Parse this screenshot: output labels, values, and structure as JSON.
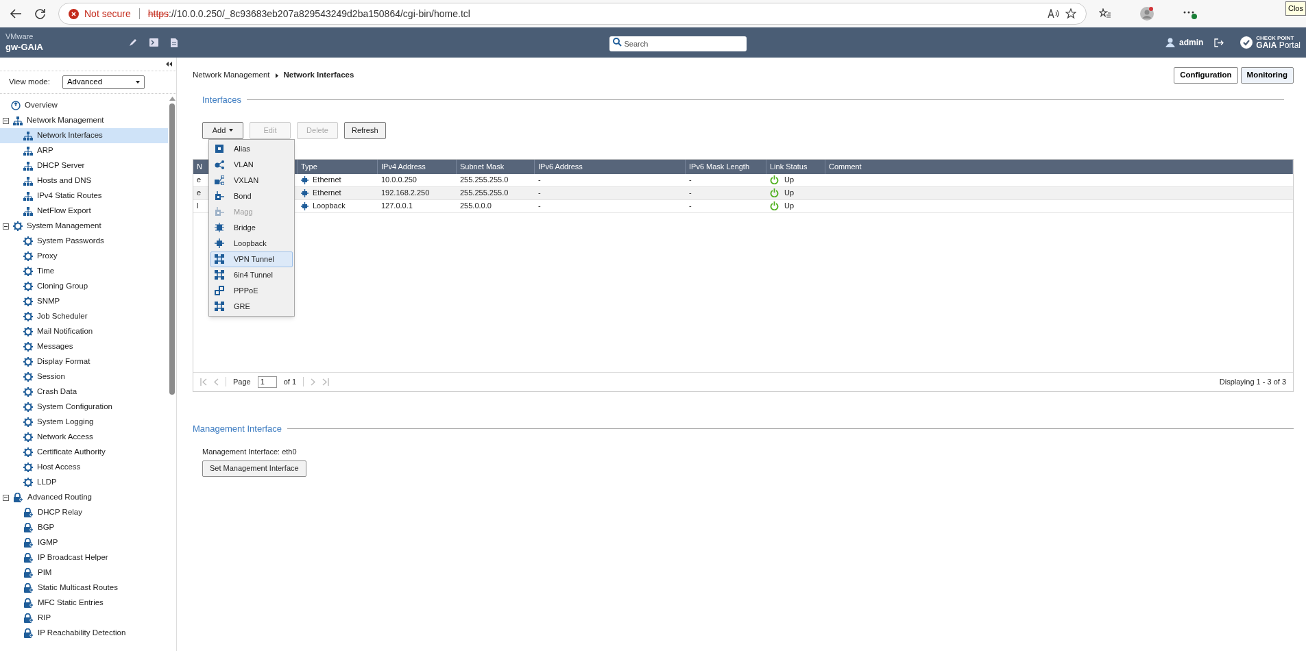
{
  "browser": {
    "security": "Not secure",
    "url_scheme": "https",
    "url_rest": "://10.0.0.250/_8c93683eb207a829543249d2ba150864/cgi-bin/home.tcl",
    "tooltip": "Clos"
  },
  "header": {
    "vendor": "VMware",
    "hostname": "gw-GAiA",
    "search": {
      "placeholder": "Search"
    },
    "user": "admin",
    "logo_top": "CHECK POINT",
    "logo_brand": "GAiA",
    "logo_word": "Portal"
  },
  "sidebar": {
    "view_mode_label": "View mode:",
    "view_mode": "Advanced",
    "tree": [
      {
        "label": "Overview",
        "kind": "overview",
        "selected": false
      },
      {
        "label": "Network Management",
        "kind": "network",
        "expanded": true,
        "selected": false,
        "children": [
          {
            "label": "Network Interfaces",
            "kind": "network",
            "selected": true
          },
          {
            "label": "ARP",
            "kind": "network",
            "selected": false
          },
          {
            "label": "DHCP Server",
            "kind": "network",
            "selected": false
          },
          {
            "label": "Hosts and DNS",
            "kind": "network",
            "selected": false
          },
          {
            "label": "IPv4 Static Routes",
            "kind": "network",
            "selected": false
          },
          {
            "label": "NetFlow Export",
            "kind": "network",
            "selected": false
          }
        ]
      },
      {
        "label": "System Management",
        "kind": "gear",
        "expanded": true,
        "selected": false,
        "children": [
          {
            "label": "System Passwords",
            "kind": "gear",
            "selected": false
          },
          {
            "label": "Proxy",
            "kind": "gear",
            "selected": false
          },
          {
            "label": "Time",
            "kind": "gear",
            "selected": false
          },
          {
            "label": "Cloning Group",
            "kind": "gear",
            "selected": false
          },
          {
            "label": "SNMP",
            "kind": "gear",
            "selected": false
          },
          {
            "label": "Job Scheduler",
            "kind": "gear",
            "selected": false
          },
          {
            "label": "Mail Notification",
            "kind": "gear",
            "selected": false
          },
          {
            "label": "Messages",
            "kind": "gear",
            "selected": false
          },
          {
            "label": "Display Format",
            "kind": "gear",
            "selected": false
          },
          {
            "label": "Session",
            "kind": "gear",
            "selected": false
          },
          {
            "label": "Crash Data",
            "kind": "gear",
            "selected": false
          },
          {
            "label": "System Configuration",
            "kind": "gear",
            "selected": false
          },
          {
            "label": "System Logging",
            "kind": "gear",
            "selected": false
          },
          {
            "label": "Network Access",
            "kind": "gear",
            "selected": false
          },
          {
            "label": "Certificate Authority",
            "kind": "gear",
            "selected": false
          },
          {
            "label": "Host Access",
            "kind": "gear",
            "selected": false
          },
          {
            "label": "LLDP",
            "kind": "gear",
            "selected": false
          }
        ]
      },
      {
        "label": "Advanced Routing",
        "kind": "lock",
        "expanded": true,
        "selected": false,
        "children": [
          {
            "label": "DHCP Relay",
            "kind": "lock",
            "selected": false
          },
          {
            "label": "BGP",
            "kind": "lock",
            "selected": false
          },
          {
            "label": "IGMP",
            "kind": "lock",
            "selected": false
          },
          {
            "label": "IP Broadcast Helper",
            "kind": "lock",
            "selected": false
          },
          {
            "label": "PIM",
            "kind": "lock",
            "selected": false
          },
          {
            "label": "Static Multicast Routes",
            "kind": "lock",
            "selected": false
          },
          {
            "label": "MFC Static Entries",
            "kind": "lock",
            "selected": false
          },
          {
            "label": "RIP",
            "kind": "lock",
            "selected": false
          },
          {
            "label": "IP Reachability Detection",
            "kind": "lock",
            "selected": false
          }
        ]
      }
    ]
  },
  "breadcrumb": [
    "Network Management",
    "Network Interfaces"
  ],
  "mode_buttons": [
    {
      "label": "Configuration",
      "selected": false
    },
    {
      "label": "Monitoring",
      "selected": true
    }
  ],
  "interfaces": {
    "title": "Interfaces",
    "toolbar": [
      {
        "label": "Add",
        "disabled": false,
        "dropdown": true
      },
      {
        "label": "Edit",
        "disabled": true,
        "dropdown": false
      },
      {
        "label": "Delete",
        "disabled": true,
        "dropdown": false
      },
      {
        "label": "Refresh",
        "disabled": false,
        "dropdown": false
      }
    ],
    "add_menu": [
      {
        "label": "Alias",
        "kind": "square",
        "disabled": false,
        "selected": false
      },
      {
        "label": "VLAN",
        "kind": "share",
        "disabled": false,
        "selected": false
      },
      {
        "label": "VXLAN",
        "kind": "branch",
        "disabled": false,
        "selected": false
      },
      {
        "label": "Bond",
        "kind": "bond",
        "disabled": false,
        "selected": false
      },
      {
        "label": "Magg",
        "kind": "bond",
        "disabled": true,
        "selected": false
      },
      {
        "label": "Bridge",
        "kind": "bridge",
        "disabled": false,
        "selected": false
      },
      {
        "label": "Loopback",
        "kind": "chip",
        "disabled": false,
        "selected": false
      },
      {
        "label": "VPN Tunnel",
        "kind": "tunnel",
        "disabled": false,
        "selected": true
      },
      {
        "label": "6in4 Tunnel",
        "kind": "tunnel",
        "disabled": false,
        "selected": false
      },
      {
        "label": "PPPoE",
        "kind": "link",
        "disabled": false,
        "selected": false
      },
      {
        "label": "GRE",
        "kind": "tunnel",
        "disabled": false,
        "selected": false
      }
    ],
    "columns": [
      "N",
      "Type",
      "IPv4 Address",
      "Subnet Mask",
      "IPv6 Address",
      "IPv6 Mask Length",
      "Link Status",
      "Comment"
    ],
    "rows": [
      {
        "column_1": "e",
        "type": "Ethernet",
        "ipv4": "10.0.0.250",
        "mask": "255.255.255.0",
        "ipv6": "-",
        "ipv6_mask": "-",
        "status": "Up",
        "up": true
      },
      {
        "column_1": "e",
        "type": "Ethernet",
        "ipv4": "192.168.2.250",
        "mask": "255.255.255.0",
        "ipv6": "-",
        "ipv6_mask": "-",
        "status": "Up",
        "up": true
      },
      {
        "column_1": "l",
        "type": "Loopback",
        "ipv4": "127.0.0.1",
        "mask": "255.0.0.0",
        "ipv6": "-",
        "ipv6_mask": "-",
        "status": "Up",
        "up": true
      }
    ],
    "pager": {
      "page_label": "Page",
      "page": "1",
      "of": "of 1",
      "display": "Displaying 1 - 3 of 3"
    }
  },
  "management": {
    "title": "Management Interface",
    "text": "Management Interface: eth0",
    "button": "Set Management Interface"
  }
}
